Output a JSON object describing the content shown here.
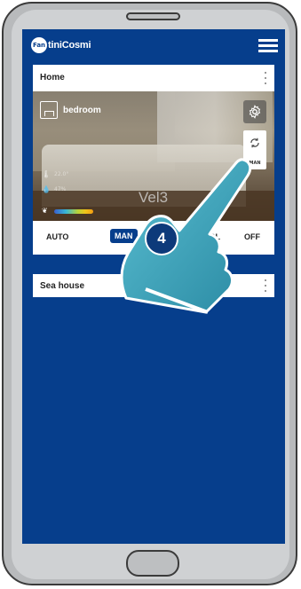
{
  "app": {
    "brand_text": "tiniCosmi",
    "brand_mark": "Fan"
  },
  "header": {
    "menu_icon": "hamburger-menu-icon"
  },
  "homes": [
    {
      "title": "Home",
      "room": {
        "name": "bedroom",
        "temperature": "22.0°",
        "humidity": "47%",
        "fan_speed": "Vel3",
        "mode_button_label": "MAN"
      },
      "modes": [
        "AUTO",
        "MAN",
        "HOL",
        "OFF"
      ],
      "active_mode": "MAN"
    },
    {
      "title": "Sea house"
    }
  ],
  "annotation": {
    "step": "4"
  },
  "colors": {
    "brand_blue": "#063e8c",
    "card_bg": "#ffffff",
    "phone_frame": "#b8babc",
    "hand_fill": "#3ea3b8"
  },
  "icons": {
    "settings": "gear-icon",
    "mode": "mode-switch-icon",
    "temperature": "thermometer-icon",
    "humidity": "droplet-icon",
    "eco": "leaf-icon",
    "room": "bed-icon"
  }
}
